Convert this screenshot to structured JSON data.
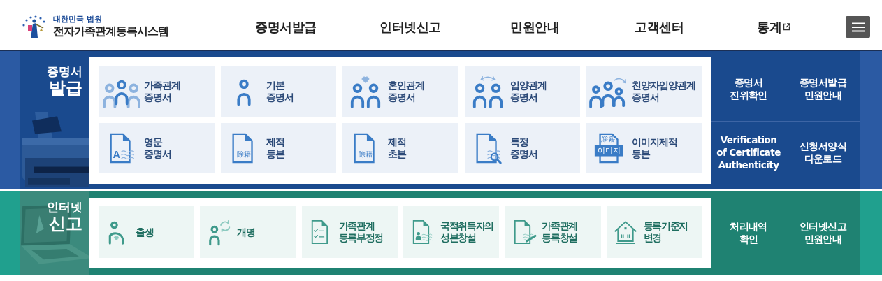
{
  "header": {
    "logo_top": "대한민국 법원",
    "logo_title": "전자가족관계등록시스템",
    "nav": [
      {
        "label": "증명서발급",
        "external": false
      },
      {
        "label": "인터넷신고",
        "external": false
      },
      {
        "label": "민원안내",
        "external": false
      },
      {
        "label": "고객센터",
        "external": false
      },
      {
        "label": "통계",
        "external": true
      }
    ]
  },
  "sections": [
    {
      "kind": "certificate",
      "title_small": "증명서",
      "title_large": "발급",
      "tiles": [
        {
          "text": "가족관계\n증명서"
        },
        {
          "text": "기본\n증명서"
        },
        {
          "text": "혼인관계\n증명서"
        },
        {
          "text": "입양관계\n증명서"
        },
        {
          "text": "친양자입양관계\n증명서"
        },
        {
          "text": "영문\n증명서",
          "icon_label": "A"
        },
        {
          "text": "제적\n등본",
          "icon_label": "除籍"
        },
        {
          "text": "제적\n초본",
          "icon_label": "除籍"
        },
        {
          "text": "특정\n증명서"
        },
        {
          "text": "이미지제적\n등본",
          "icon_label": "이미지",
          "icon_caption": "除籍"
        }
      ],
      "links": [
        {
          "text": "증명서\n진위확인"
        },
        {
          "text": "증명서발급\n민원안내"
        },
        {
          "text": "Verification of Certificate Authenticity"
        },
        {
          "text": "신청서양식\n다운로드"
        }
      ]
    },
    {
      "kind": "report",
      "title_small": "인터넷",
      "title_large": "신고",
      "tiles": [
        {
          "text": "출생"
        },
        {
          "text": "개명"
        },
        {
          "text": "가족관계\n등록부정정"
        },
        {
          "text": "국적취득자의\n성본창설"
        },
        {
          "text": "가족관계\n등록창설"
        },
        {
          "text": "등록기준지\n변경"
        }
      ],
      "links": [
        {
          "text": "처리내역\n확인"
        },
        {
          "text": "인터넷신고\n민원안내"
        }
      ]
    }
  ]
}
